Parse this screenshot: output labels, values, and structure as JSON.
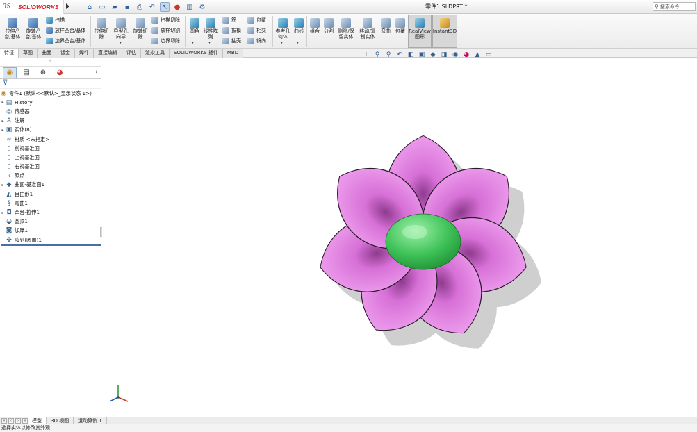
{
  "titlebar": {
    "brand": "SOLIDWORKS",
    "doc_title": "零件1.SLDPRT *",
    "search_placeholder": "搜索命令"
  },
  "command_manager": {
    "extrude_boss": "拉伸凸\n台/基体",
    "revolve_boss": "旋转凸\n台/基体",
    "sweep": "扫描",
    "loft_boss": "放样凸台/基体",
    "boundary_boss": "边界凸台/基体",
    "extrude_cut": "拉伸切\n除",
    "hole_wizard": "异型孔\n向导",
    "revolve_cut": "旋转切\n除",
    "swept_cut": "扫描切除",
    "lofted_cut": "放样切割",
    "boundary_cut": "边界切除",
    "fillet": "圆角",
    "linear_pattern": "线性阵\n列",
    "rib": "筋",
    "draft": "拔模",
    "shell": "抽壳",
    "wrap": "包覆",
    "intersect": "相交",
    "mirror": "镜向",
    "ref_geometry": "参考几\n何体",
    "curves": "曲线",
    "combine": "组合",
    "split": "分割",
    "delete_body": "删除/保\n留实体",
    "move_copy": "移动/复\n制实体",
    "flex": "弯曲",
    "wrap2": "包覆",
    "realview": "RealView\n图形",
    "instant3d": "Instant3D"
  },
  "tabs": [
    "特征",
    "草图",
    "曲面",
    "钣金",
    "焊件",
    "直接编辑",
    "评估",
    "渲染工具",
    "SOLIDWORKS 插件",
    "MBD"
  ],
  "feature_tree": {
    "root": "零件1 (默认<<默认>_显示状态 1>)",
    "items": [
      {
        "label": "History",
        "icon": "history-icon",
        "glyph": "▤",
        "expandable": true
      },
      {
        "label": "传感器",
        "icon": "sensor-icon",
        "glyph": "◎",
        "expandable": false
      },
      {
        "label": "注解",
        "icon": "annotation-icon",
        "glyph": "A",
        "expandable": true
      },
      {
        "label": "实体(8)",
        "icon": "solid-bodies-icon",
        "glyph": "▣",
        "expandable": true
      },
      {
        "label": "材质 <未指定>",
        "icon": "material-icon",
        "glyph": "≋",
        "expandable": false
      },
      {
        "label": "前视基准面",
        "icon": "plane-icon",
        "glyph": "▯",
        "expandable": false
      },
      {
        "label": "上视基准面",
        "icon": "plane-icon",
        "glyph": "▯",
        "expandable": false
      },
      {
        "label": "右视基准面",
        "icon": "plane-icon",
        "glyph": "▯",
        "expandable": false
      },
      {
        "label": "原点",
        "icon": "origin-icon",
        "glyph": "↳",
        "expandable": false
      },
      {
        "label": "曲面-基准面1",
        "icon": "planar-surface-icon",
        "glyph": "◆",
        "expandable": true
      },
      {
        "label": "自由形1",
        "icon": "freeform-icon",
        "glyph": "◭",
        "expandable": false
      },
      {
        "label": "弯曲1",
        "icon": "flex-icon",
        "glyph": "§",
        "expandable": false
      },
      {
        "label": "凸台-拉伸1",
        "icon": "extrude-icon",
        "glyph": "◘",
        "expandable": true
      },
      {
        "label": "圆顶1",
        "icon": "dome-icon",
        "glyph": "◒",
        "expandable": false
      },
      {
        "label": "加厚1",
        "icon": "thicken-icon",
        "glyph": "◙",
        "expandable": false
      },
      {
        "label": "阵列(圆周)1",
        "icon": "circular-pattern-icon",
        "glyph": "✣",
        "expandable": false
      }
    ]
  },
  "bottom_tabs": [
    "模型",
    "3D 视图",
    "运动算例 1"
  ],
  "status": "选择实体以修改其外观",
  "colors": {
    "petal_light": "#f0a2f0",
    "petal_mid": "#d770d7",
    "petal_dark": "#8e3a8e",
    "center_light": "#9cf0a8",
    "center_dark": "#1e8a34",
    "shadow": "#cfcfcf",
    "accent": "#4a6fa5"
  }
}
